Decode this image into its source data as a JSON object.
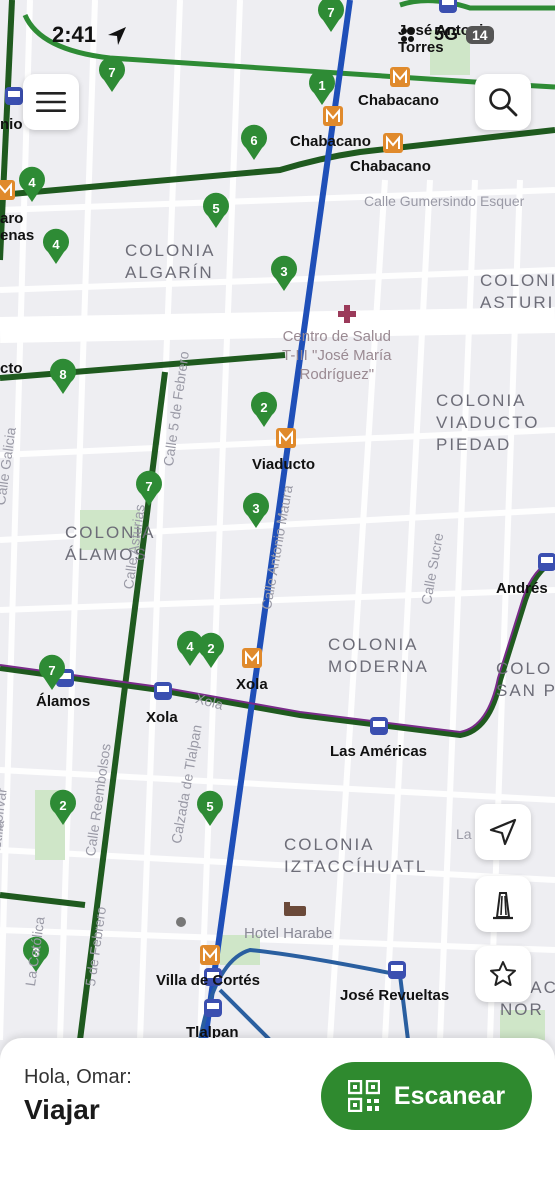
{
  "status_bar": {
    "time": "2:41",
    "network": "5G",
    "battery": "14"
  },
  "map": {
    "station_labels": [
      {
        "id": "jose-antonio-torres",
        "text": "José Antonio\nTorres"
      },
      {
        "id": "chabacano-1",
        "text": "Chabacano"
      },
      {
        "id": "chabacano-2",
        "text": "Chabacano"
      },
      {
        "id": "chabacano-3",
        "text": "Chabacano"
      },
      {
        "id": "viaducto",
        "text": "Viaducto"
      },
      {
        "id": "xola-metro",
        "text": "Xola"
      },
      {
        "id": "xola-bus",
        "text": "Xola"
      },
      {
        "id": "alamos",
        "text": "Álamos"
      },
      {
        "id": "las-americas",
        "text": "Las Américas"
      },
      {
        "id": "andres",
        "text": "Andrés"
      },
      {
        "id": "villa-de-cortes",
        "text": "Villa de Cortés"
      },
      {
        "id": "jose-revueltas",
        "text": "José Revueltas"
      },
      {
        "id": "tlalpan",
        "text": "Tlalpan"
      },
      {
        "id": "edge-nio",
        "text": "nio"
      },
      {
        "id": "edge-aro",
        "text": "aro\nenas"
      },
      {
        "id": "edge-cto",
        "text": "cto"
      }
    ],
    "colonia_labels": [
      {
        "id": "algarin",
        "text": "COLONIA\nALGARÍN"
      },
      {
        "id": "asturias",
        "text": "COLONIA\nASTURI"
      },
      {
        "id": "viaducto-piedad",
        "text": "COLONIA\nVIADUCTO\nPIEDAD"
      },
      {
        "id": "alamos",
        "text": "COLONIA\nÁLAMOS"
      },
      {
        "id": "moderna",
        "text": "COLONIA\nMODERNA"
      },
      {
        "id": "san-p",
        "text": "COLO\nSAN P"
      },
      {
        "id": "iztaccihuatl",
        "text": "COLONIA\nIZTACCÍHUATL"
      },
      {
        "id": "iztacci-right",
        "text": "LO\nIZTACCÍ\nNOR"
      }
    ],
    "street_labels": [
      {
        "id": "gumersindo",
        "text": "Calle Gumersindo Esquer"
      },
      {
        "id": "simon-bolivar",
        "text": "Calle José Simón Bolívar"
      },
      {
        "id": "galicia",
        "text": "Calle Galicia"
      },
      {
        "id": "cinco-febrero",
        "text": "Calle 5 de Febrero"
      },
      {
        "id": "asturias",
        "text": "Calle Asturias"
      },
      {
        "id": "antonio-maura",
        "text": "Calle Antonio Maura"
      },
      {
        "id": "sucre",
        "text": "Calle Sucre"
      },
      {
        "id": "xola",
        "text": "Xola"
      },
      {
        "id": "bolivar",
        "text": "Bolívar"
      },
      {
        "id": "castilla",
        "text": "Calle Castilla"
      },
      {
        "id": "reembolsos",
        "text": "Calle Reembolsos"
      },
      {
        "id": "calzada-tlalpan",
        "text": "Calzada de Tlalpan"
      },
      {
        "id": "la-catolica",
        "text": "La Católica"
      },
      {
        "id": "cinco-feb-south",
        "text": "5 de Febrero"
      },
      {
        "id": "la",
        "text": "La"
      }
    ],
    "poi_labels": [
      {
        "id": "centro-salud",
        "text": "Centro de Salud\nT-III \"José María\nRodríguez\""
      },
      {
        "id": "hotel-harabe",
        "text": "Hotel Harabe"
      }
    ],
    "bike_docks": [
      {
        "id": "d1",
        "count": "7"
      },
      {
        "id": "d2",
        "count": "7"
      },
      {
        "id": "d3",
        "count": "1"
      },
      {
        "id": "d4",
        "count": "6"
      },
      {
        "id": "d5",
        "count": "4"
      },
      {
        "id": "d6",
        "count": "5"
      },
      {
        "id": "d7",
        "count": "4"
      },
      {
        "id": "d8",
        "count": "3"
      },
      {
        "id": "d9",
        "count": "8"
      },
      {
        "id": "d10",
        "count": "2"
      },
      {
        "id": "d11",
        "count": "7"
      },
      {
        "id": "d12",
        "count": "3"
      },
      {
        "id": "d13",
        "count": "4"
      },
      {
        "id": "d14",
        "count": "2"
      },
      {
        "id": "d15",
        "count": "7"
      },
      {
        "id": "d16",
        "count": "2"
      },
      {
        "id": "d17",
        "count": "5"
      },
      {
        "id": "d18",
        "count": "3"
      }
    ]
  },
  "colors": {
    "metro_blue": "#1f4fb8",
    "metrobus_green": "#1f5a1f",
    "dock_green": "#2e8b35",
    "brand_green": "#2f8a2f",
    "metro_orange": "#e08a2c",
    "bus_blue": "#3b4fb0",
    "route_purple": "#7a2b8a"
  },
  "buttons": {
    "menu": "menu-icon",
    "search": "search-icon",
    "locate": "navigation-arrow-icon",
    "monument": "monument-icon",
    "favorites": "star-icon"
  },
  "bottom_sheet": {
    "greeting": "Hola, Omar:",
    "title": "Viajar",
    "scan_label": "Escanear"
  }
}
